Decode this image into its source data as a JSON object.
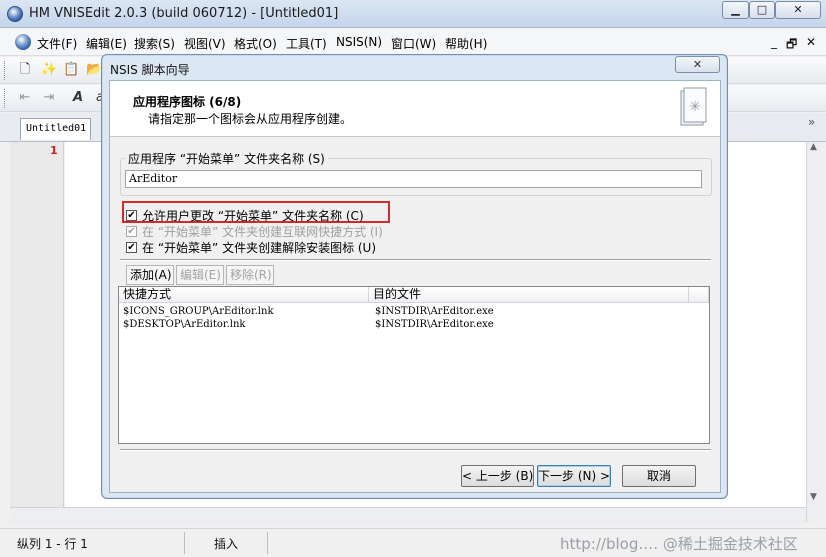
{
  "window": {
    "title": "HM VNISEdit 2.0.3 (build 060712) - [Untitled01]",
    "controls": [
      "▁",
      "□",
      "✕"
    ]
  },
  "menu": {
    "items": [
      "文件(F)",
      "编辑(E)",
      "搜索(S)",
      "视图(V)",
      "格式(O)",
      "工具(T)",
      "NSIS(N)",
      "窗口(W)",
      "帮助(H)"
    ],
    "mdi_controls": [
      "_",
      "🗗",
      "✕"
    ]
  },
  "doc_tab": {
    "label": "Untitled01",
    "overflow": "»"
  },
  "editor": {
    "line_number": "1"
  },
  "status": {
    "position": "纵列 1 - 行 1",
    "mode": "插入",
    "watermark": "http://blog.… @稀土掘金技术社区"
  },
  "dialog": {
    "title": "NSIS 脚本向导",
    "close": "✕",
    "header_title": "应用程序图标 (6/8)",
    "header_subtitle": "请指定那一个图标会从应用程序创建。",
    "group_label": "应用程序 “开始菜单” 文件夹名称 (S)",
    "folder_value": "ArEditor",
    "checkboxes": [
      {
        "label": "允许用户更改 “开始菜单” 文件夹名称 (C)",
        "checked": "✔"
      },
      {
        "label": "在 “开始菜单” 文件夹创建互联网快捷方式 (I)",
        "checked": "✔"
      },
      {
        "label": "在 “开始菜单” 文件夹创建解除安装图标 (U)",
        "checked": "✔"
      }
    ],
    "list_buttons": [
      "添加(A)",
      "编辑(E)",
      "移除(R)"
    ],
    "columns": [
      "快捷方式",
      "目的文件"
    ],
    "rows": [
      {
        "shortcut": "$ICONS_GROUP\\ArEditor.lnk",
        "target": "$INSTDIR\\ArEditor.exe"
      },
      {
        "shortcut": "$DESKTOP\\ArEditor.lnk",
        "target": "$INSTDIR\\ArEditor.exe"
      }
    ],
    "back_label": "< 上一步 (B)",
    "next_label": "下一步 (N) >",
    "cancel_label": "取消"
  },
  "colors": {
    "highlight": "#d02a2a",
    "line_number": "#d02020"
  }
}
